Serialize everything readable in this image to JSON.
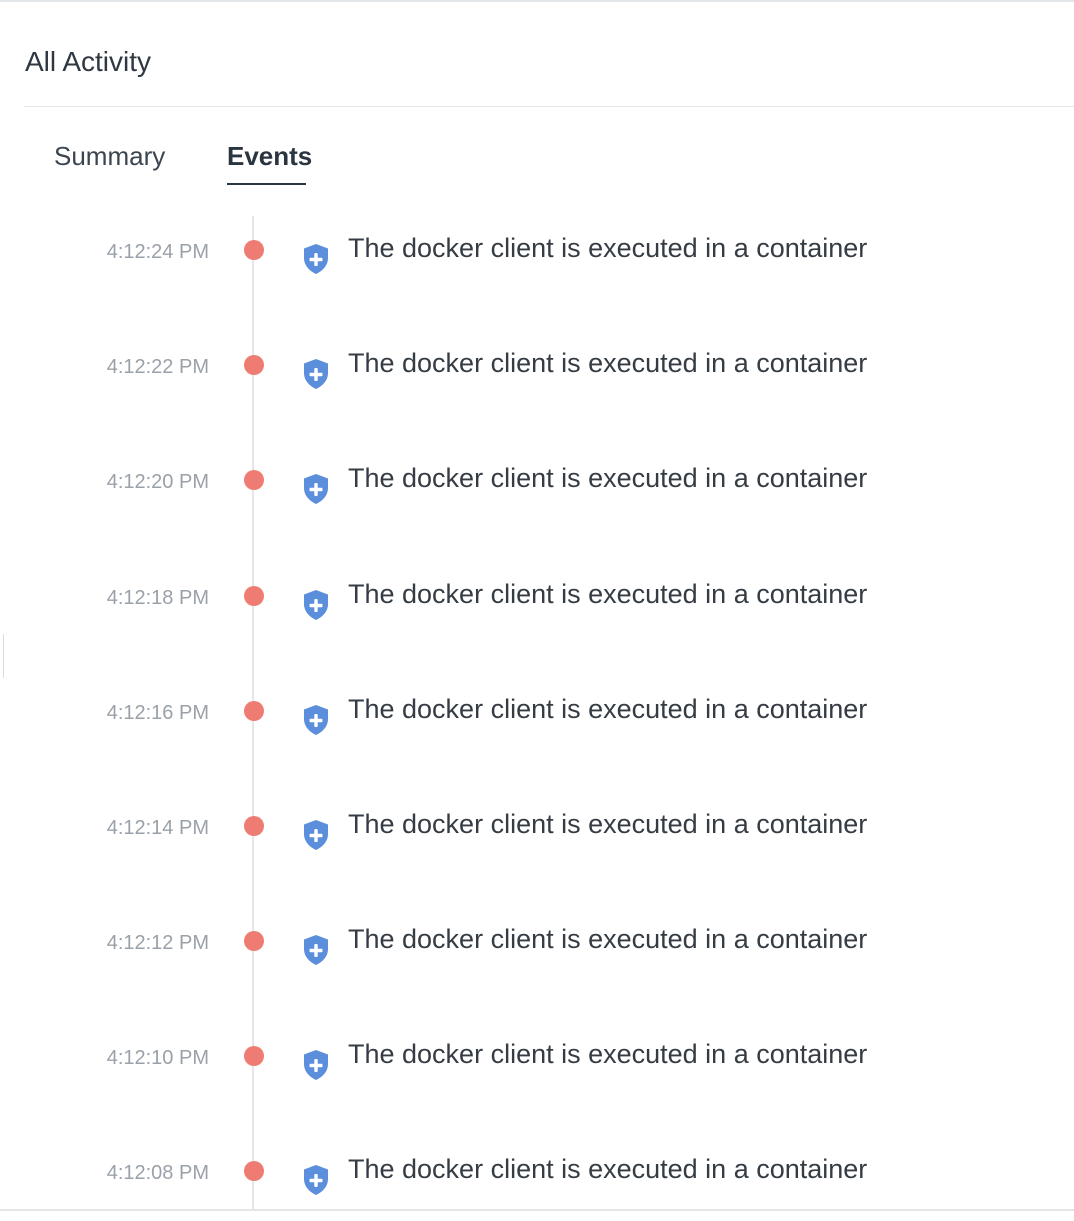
{
  "panel": {
    "title": "All Activity"
  },
  "tabs": [
    {
      "label": "Summary",
      "active": false
    },
    {
      "label": "Events",
      "active": true
    }
  ],
  "colors": {
    "event_dot": "#ee7c72",
    "shield_icon": "#5b8fdc",
    "active_tab": "#2b3540"
  },
  "events": [
    {
      "time": "4:12:24 PM",
      "icon": "shield-plus-icon",
      "description": "The docker client is executed in a container"
    },
    {
      "time": "4:12:22 PM",
      "icon": "shield-plus-icon",
      "description": "The docker client is executed in a container"
    },
    {
      "time": "4:12:20 PM",
      "icon": "shield-plus-icon",
      "description": "The docker client is executed in a container"
    },
    {
      "time": "4:12:18 PM",
      "icon": "shield-plus-icon",
      "description": "The docker client is executed in a container"
    },
    {
      "time": "4:12:16 PM",
      "icon": "shield-plus-icon",
      "description": "The docker client is executed in a container"
    },
    {
      "time": "4:12:14 PM",
      "icon": "shield-plus-icon",
      "description": "The docker client is executed in a container"
    },
    {
      "time": "4:12:12 PM",
      "icon": "shield-plus-icon",
      "description": "The docker client is executed in a container"
    },
    {
      "time": "4:12:10 PM",
      "icon": "shield-plus-icon",
      "description": "The docker client is executed in a container"
    },
    {
      "time": "4:12:08 PM",
      "icon": "shield-plus-icon",
      "description": "The docker client is executed in a container"
    }
  ]
}
